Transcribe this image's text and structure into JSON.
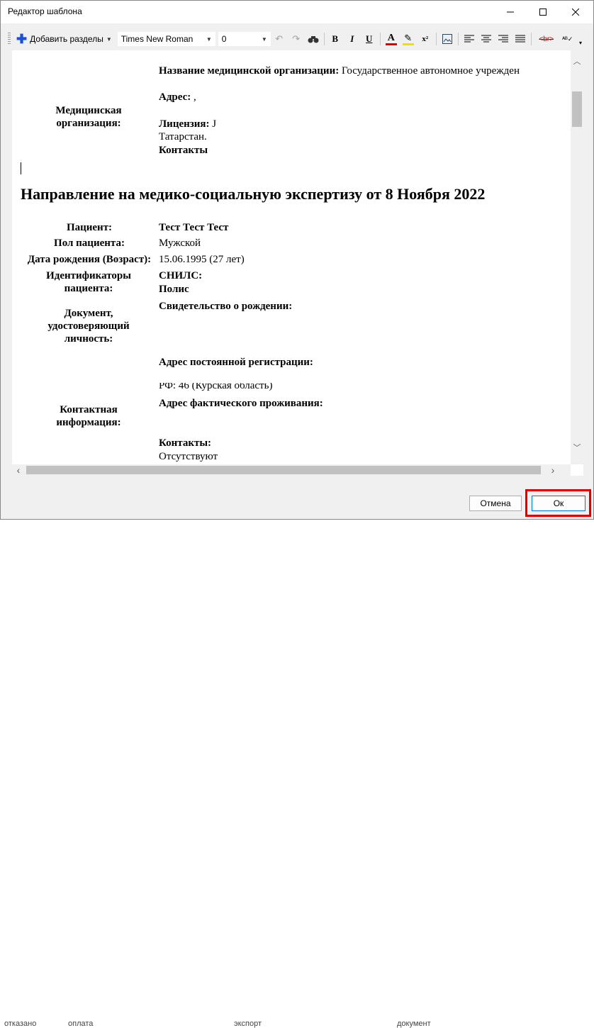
{
  "window": {
    "title": "Редактор шаблона"
  },
  "toolbar": {
    "add_sections": "Добавить разделы",
    "font_name": "Times New Roman",
    "font_size": "0",
    "bold": "B",
    "italic": "I",
    "underline": "U",
    "font_color": "A",
    "superscript": "x²",
    "br_tag": "<br>"
  },
  "document": {
    "org_label": "Медицинская организация:",
    "org_name_label": "Название медицинской организации:",
    "org_name_value": " Государственное автономное учрежден",
    "address_label": "Адрес:",
    "address_value": " ,",
    "license_label": "Лицензия:",
    "license_value": " J",
    "license_line2": "Татарстан.",
    "contacts_label": "Контакты",
    "heading": "Направление на медико-социальную экспертизу от 8 Ноября 2022",
    "patient_label": "Пациент:",
    "patient_value": "Тест Тест Тест",
    "gender_label": "Пол пациента:",
    "gender_value": "Мужской",
    "dob_label": "Дата рождения (Возраст):",
    "dob_value": "15.06.1995 (27 лет)",
    "ids_label": "Идентификаторы пациента:",
    "snils_label": "СНИЛС:",
    "policy_label": "Полис",
    "doc_label": "Документ, удостоверяющий личность:",
    "birth_cert_label": "Свидетельство о рождении:",
    "contact_info_label": "Контактная информация:",
    "reg_address_label": "Адрес постоянной регистрации:",
    "reg_address_value": "РФ: 46 (Курская область)",
    "actual_address_label": "Адрес фактического проживания:",
    "contacts2_label": "Контакты:",
    "contacts2_value": "Отсутствуют"
  },
  "buttons": {
    "cancel": "Отмена",
    "ok": "Ок"
  },
  "background": {
    "text1": "отказано",
    "text2": "оплата",
    "text3": "экспорт",
    "text4": "документ"
  },
  "colors": {
    "accent_plus": "#1a4fd6",
    "highlight_border": "#e00000",
    "font_color_bar": "#e00000",
    "highlighter_bar": "#f0e000"
  },
  "icons": [
    "plus-icon",
    "undo-icon",
    "redo-icon",
    "find-icon",
    "font-color-icon",
    "highlighter-icon",
    "image-icon",
    "align-left-icon",
    "align-center-icon",
    "align-right-icon",
    "align-justify-icon",
    "spell-check-icon"
  ]
}
